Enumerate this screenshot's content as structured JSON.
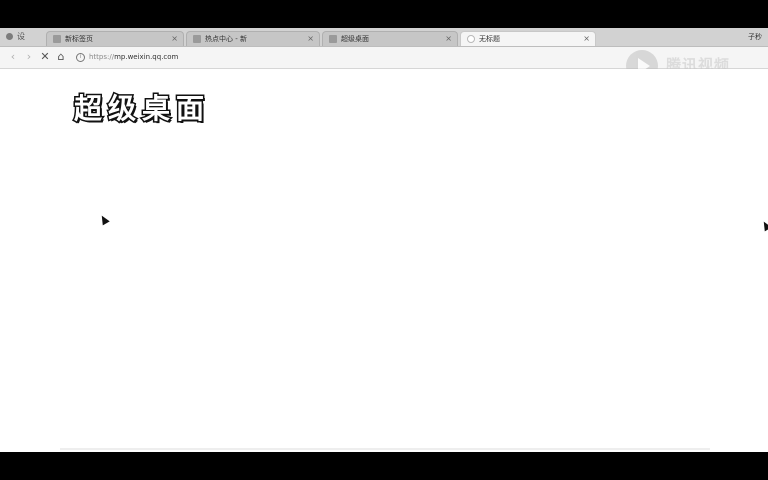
{
  "window": {
    "menu_label": "设"
  },
  "tabs": [
    {
      "label": "新标签页",
      "close": "×",
      "active": false
    },
    {
      "label": "热点中心 - 新",
      "close": "×",
      "active": false
    },
    {
      "label": "超级桌面",
      "close": "×",
      "active": false
    },
    {
      "label": "无标题",
      "close": "×",
      "active": true
    }
  ],
  "profile": {
    "label": "子秒"
  },
  "toolbar": {
    "stop_icon": "✕",
    "home_icon": "⌂",
    "info_icon": "i",
    "url_protocol": "https://",
    "url_host": "mp.weixin.qq.com"
  },
  "watermark": {
    "text": "腾讯视频"
  },
  "page": {
    "headline": "超级桌面"
  }
}
